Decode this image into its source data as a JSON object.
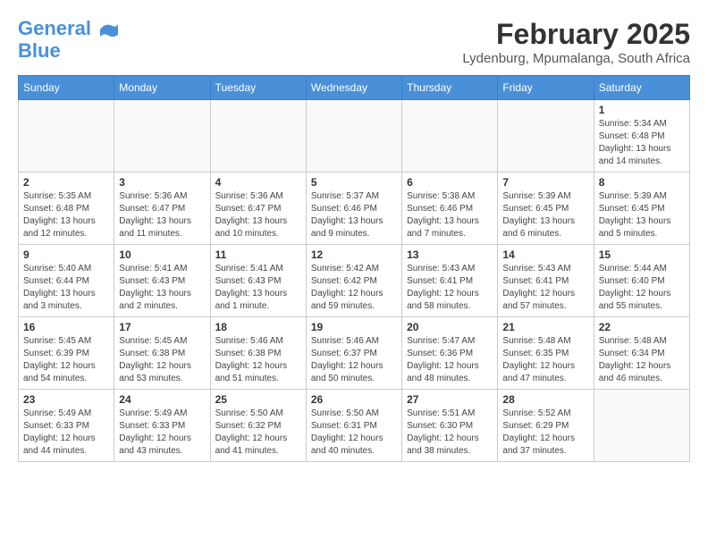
{
  "header": {
    "logo_line1": "General",
    "logo_line2": "Blue",
    "month_title": "February 2025",
    "location": "Lydenburg, Mpumalanga, South Africa"
  },
  "weekdays": [
    "Sunday",
    "Monday",
    "Tuesday",
    "Wednesday",
    "Thursday",
    "Friday",
    "Saturday"
  ],
  "weeks": [
    [
      {
        "day": "",
        "info": ""
      },
      {
        "day": "",
        "info": ""
      },
      {
        "day": "",
        "info": ""
      },
      {
        "day": "",
        "info": ""
      },
      {
        "day": "",
        "info": ""
      },
      {
        "day": "",
        "info": ""
      },
      {
        "day": "1",
        "info": "Sunrise: 5:34 AM\nSunset: 6:48 PM\nDaylight: 13 hours\nand 14 minutes."
      }
    ],
    [
      {
        "day": "2",
        "info": "Sunrise: 5:35 AM\nSunset: 6:48 PM\nDaylight: 13 hours\nand 12 minutes."
      },
      {
        "day": "3",
        "info": "Sunrise: 5:36 AM\nSunset: 6:47 PM\nDaylight: 13 hours\nand 11 minutes."
      },
      {
        "day": "4",
        "info": "Sunrise: 5:36 AM\nSunset: 6:47 PM\nDaylight: 13 hours\nand 10 minutes."
      },
      {
        "day": "5",
        "info": "Sunrise: 5:37 AM\nSunset: 6:46 PM\nDaylight: 13 hours\nand 9 minutes."
      },
      {
        "day": "6",
        "info": "Sunrise: 5:38 AM\nSunset: 6:46 PM\nDaylight: 13 hours\nand 7 minutes."
      },
      {
        "day": "7",
        "info": "Sunrise: 5:39 AM\nSunset: 6:45 PM\nDaylight: 13 hours\nand 6 minutes."
      },
      {
        "day": "8",
        "info": "Sunrise: 5:39 AM\nSunset: 6:45 PM\nDaylight: 13 hours\nand 5 minutes."
      }
    ],
    [
      {
        "day": "9",
        "info": "Sunrise: 5:40 AM\nSunset: 6:44 PM\nDaylight: 13 hours\nand 3 minutes."
      },
      {
        "day": "10",
        "info": "Sunrise: 5:41 AM\nSunset: 6:43 PM\nDaylight: 13 hours\nand 2 minutes."
      },
      {
        "day": "11",
        "info": "Sunrise: 5:41 AM\nSunset: 6:43 PM\nDaylight: 13 hours\nand 1 minute."
      },
      {
        "day": "12",
        "info": "Sunrise: 5:42 AM\nSunset: 6:42 PM\nDaylight: 12 hours\nand 59 minutes."
      },
      {
        "day": "13",
        "info": "Sunrise: 5:43 AM\nSunset: 6:41 PM\nDaylight: 12 hours\nand 58 minutes."
      },
      {
        "day": "14",
        "info": "Sunrise: 5:43 AM\nSunset: 6:41 PM\nDaylight: 12 hours\nand 57 minutes."
      },
      {
        "day": "15",
        "info": "Sunrise: 5:44 AM\nSunset: 6:40 PM\nDaylight: 12 hours\nand 55 minutes."
      }
    ],
    [
      {
        "day": "16",
        "info": "Sunrise: 5:45 AM\nSunset: 6:39 PM\nDaylight: 12 hours\nand 54 minutes."
      },
      {
        "day": "17",
        "info": "Sunrise: 5:45 AM\nSunset: 6:38 PM\nDaylight: 12 hours\nand 53 minutes."
      },
      {
        "day": "18",
        "info": "Sunrise: 5:46 AM\nSunset: 6:38 PM\nDaylight: 12 hours\nand 51 minutes."
      },
      {
        "day": "19",
        "info": "Sunrise: 5:46 AM\nSunset: 6:37 PM\nDaylight: 12 hours\nand 50 minutes."
      },
      {
        "day": "20",
        "info": "Sunrise: 5:47 AM\nSunset: 6:36 PM\nDaylight: 12 hours\nand 48 minutes."
      },
      {
        "day": "21",
        "info": "Sunrise: 5:48 AM\nSunset: 6:35 PM\nDaylight: 12 hours\nand 47 minutes."
      },
      {
        "day": "22",
        "info": "Sunrise: 5:48 AM\nSunset: 6:34 PM\nDaylight: 12 hours\nand 46 minutes."
      }
    ],
    [
      {
        "day": "23",
        "info": "Sunrise: 5:49 AM\nSunset: 6:33 PM\nDaylight: 12 hours\nand 44 minutes."
      },
      {
        "day": "24",
        "info": "Sunrise: 5:49 AM\nSunset: 6:33 PM\nDaylight: 12 hours\nand 43 minutes."
      },
      {
        "day": "25",
        "info": "Sunrise: 5:50 AM\nSunset: 6:32 PM\nDaylight: 12 hours\nand 41 minutes."
      },
      {
        "day": "26",
        "info": "Sunrise: 5:50 AM\nSunset: 6:31 PM\nDaylight: 12 hours\nand 40 minutes."
      },
      {
        "day": "27",
        "info": "Sunrise: 5:51 AM\nSunset: 6:30 PM\nDaylight: 12 hours\nand 38 minutes."
      },
      {
        "day": "28",
        "info": "Sunrise: 5:52 AM\nSunset: 6:29 PM\nDaylight: 12 hours\nand 37 minutes."
      },
      {
        "day": "",
        "info": ""
      }
    ]
  ]
}
